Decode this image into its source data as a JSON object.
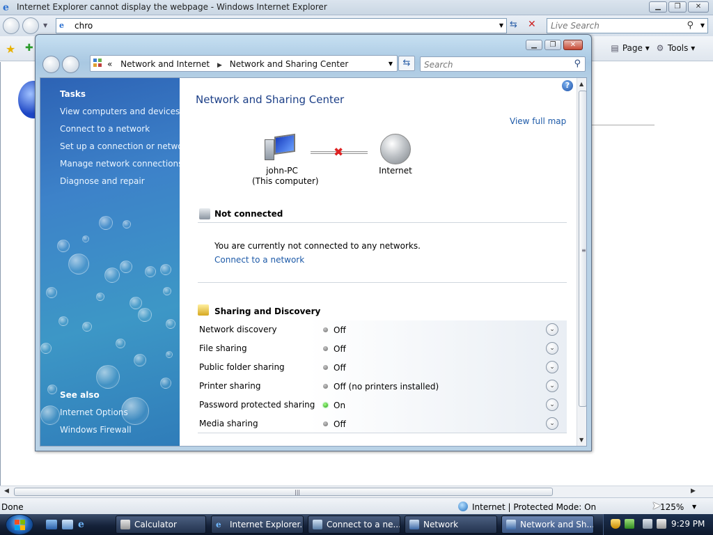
{
  "ie": {
    "title": "Internet Explorer cannot display the webpage - Windows Internet Explorer",
    "address": "chro",
    "search_placeholder": "Live Search",
    "toolbar": {
      "page": "Page",
      "tools": "Tools"
    },
    "status": {
      "done": "Done",
      "zone": "Internet | Protected Mode: On",
      "zoom": "125%"
    }
  },
  "nsc": {
    "breadcrumb": [
      "«",
      "Network and Internet",
      "Network and Sharing Center"
    ],
    "search_placeholder": "Search",
    "sidebar": {
      "tasks_heading": "Tasks",
      "tasks": [
        "View computers and devices",
        "Connect to a network",
        "Set up a connection or network",
        "Manage network connections",
        "Diagnose and repair"
      ],
      "see_also_heading": "See also",
      "see_also": [
        "Internet Options",
        "Windows Firewall"
      ]
    },
    "main": {
      "title": "Network and Sharing Center",
      "view_full_map": "View full map",
      "computer_name": "john-PC",
      "computer_sub": "(This computer)",
      "internet_label": "Internet",
      "not_connected_title": "Not connected",
      "not_connected_msg": "You are currently not connected to any networks.",
      "connect_link": "Connect to a network",
      "sharing_title": "Sharing and Discovery",
      "sharing": [
        {
          "label": "Network discovery",
          "status": "Off",
          "on": false
        },
        {
          "label": "File sharing",
          "status": "Off",
          "on": false
        },
        {
          "label": "Public folder sharing",
          "status": "Off",
          "on": false
        },
        {
          "label": "Printer sharing",
          "status": "Off (no printers installed)",
          "on": false
        },
        {
          "label": "Password protected sharing",
          "status": "On",
          "on": true
        },
        {
          "label": "Media sharing",
          "status": "Off",
          "on": false
        }
      ]
    }
  },
  "taskbar": {
    "buttons": [
      "Calculator",
      "Internet Explorer...",
      "Connect to a ne...",
      "Network",
      "Network and Sh..."
    ],
    "clock": "9:29 PM"
  },
  "colors": {
    "link": "#1d5aa8",
    "title": "#1c3f87",
    "status_on": "#1f9a12"
  }
}
